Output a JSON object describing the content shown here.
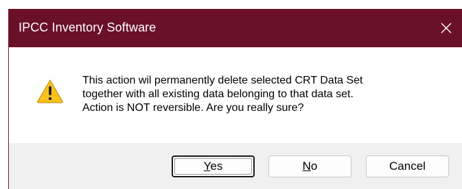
{
  "dialog": {
    "title": "IPCC Inventory Software",
    "icon": "warning-icon",
    "message_lines": [
      "This action wil permanently delete selected CRT Data Set",
      "together with all existing data belonging to that data set.",
      "Action is NOT reversible. Are you really sure?"
    ],
    "buttons": {
      "yes": {
        "mnemonic": "Y",
        "rest": "es"
      },
      "no": {
        "mnemonic": "N",
        "rest": "o"
      },
      "cancel": "Cancel"
    },
    "default_button": "Yes"
  },
  "colors": {
    "titlebar": "#6b1029",
    "footer": "#f0f0f0",
    "warning_fill": "#f9c21b"
  }
}
